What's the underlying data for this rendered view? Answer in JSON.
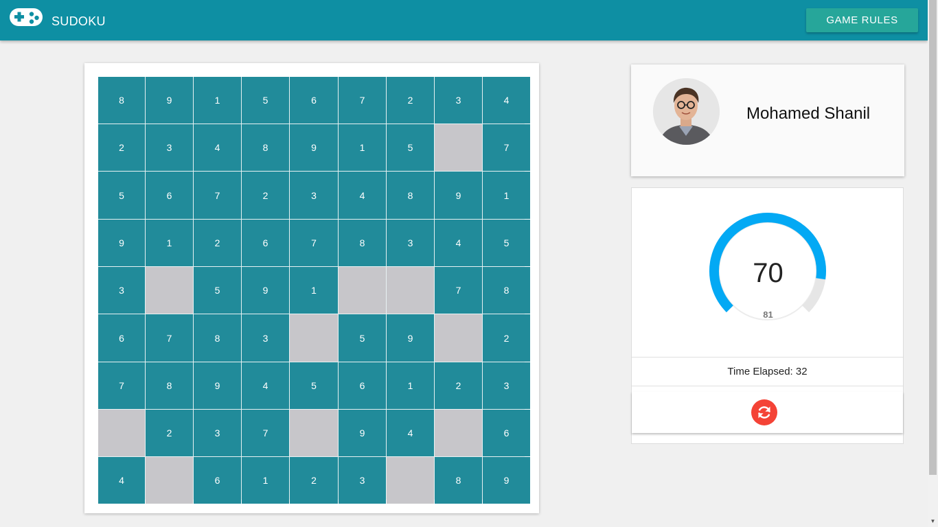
{
  "app": {
    "title": "SUDOKU",
    "logo_icon": "gamepad-icon",
    "rules_button": "GAME RULES",
    "brand_color": "#0e8fa3"
  },
  "board": {
    "filled_color": "#218b9a",
    "empty_color": "#c7c6ca",
    "rows": [
      [
        "8",
        "9",
        "1",
        "5",
        "6",
        "7",
        "2",
        "3",
        "4"
      ],
      [
        "2",
        "3",
        "4",
        "8",
        "9",
        "1",
        "5",
        "",
        "7"
      ],
      [
        "5",
        "6",
        "7",
        "2",
        "3",
        "4",
        "8",
        "9",
        "1"
      ],
      [
        "9",
        "1",
        "2",
        "6",
        "7",
        "8",
        "3",
        "4",
        "5"
      ],
      [
        "3",
        "",
        "5",
        "9",
        "1",
        "",
        "",
        "7",
        "8"
      ],
      [
        "6",
        "7",
        "8",
        "3",
        "",
        "5",
        "9",
        "",
        "2"
      ],
      [
        "7",
        "8",
        "9",
        "4",
        "5",
        "6",
        "1",
        "2",
        "3"
      ],
      [
        "",
        "2",
        "3",
        "7",
        "",
        "9",
        "4",
        "",
        "6"
      ],
      [
        "4",
        "",
        "6",
        "1",
        "2",
        "3",
        "",
        "8",
        "9"
      ]
    ]
  },
  "player": {
    "name": "Mohamed Shanil",
    "avatar_icon": "player-avatar"
  },
  "timer": {
    "value": "70",
    "max": "81",
    "fraction": 0.864,
    "gauge_color": "#03a9f4",
    "time_elapsed_label": "Time Elapsed: 32",
    "reset_icon": "refresh-icon",
    "reset_color": "#f44336"
  }
}
